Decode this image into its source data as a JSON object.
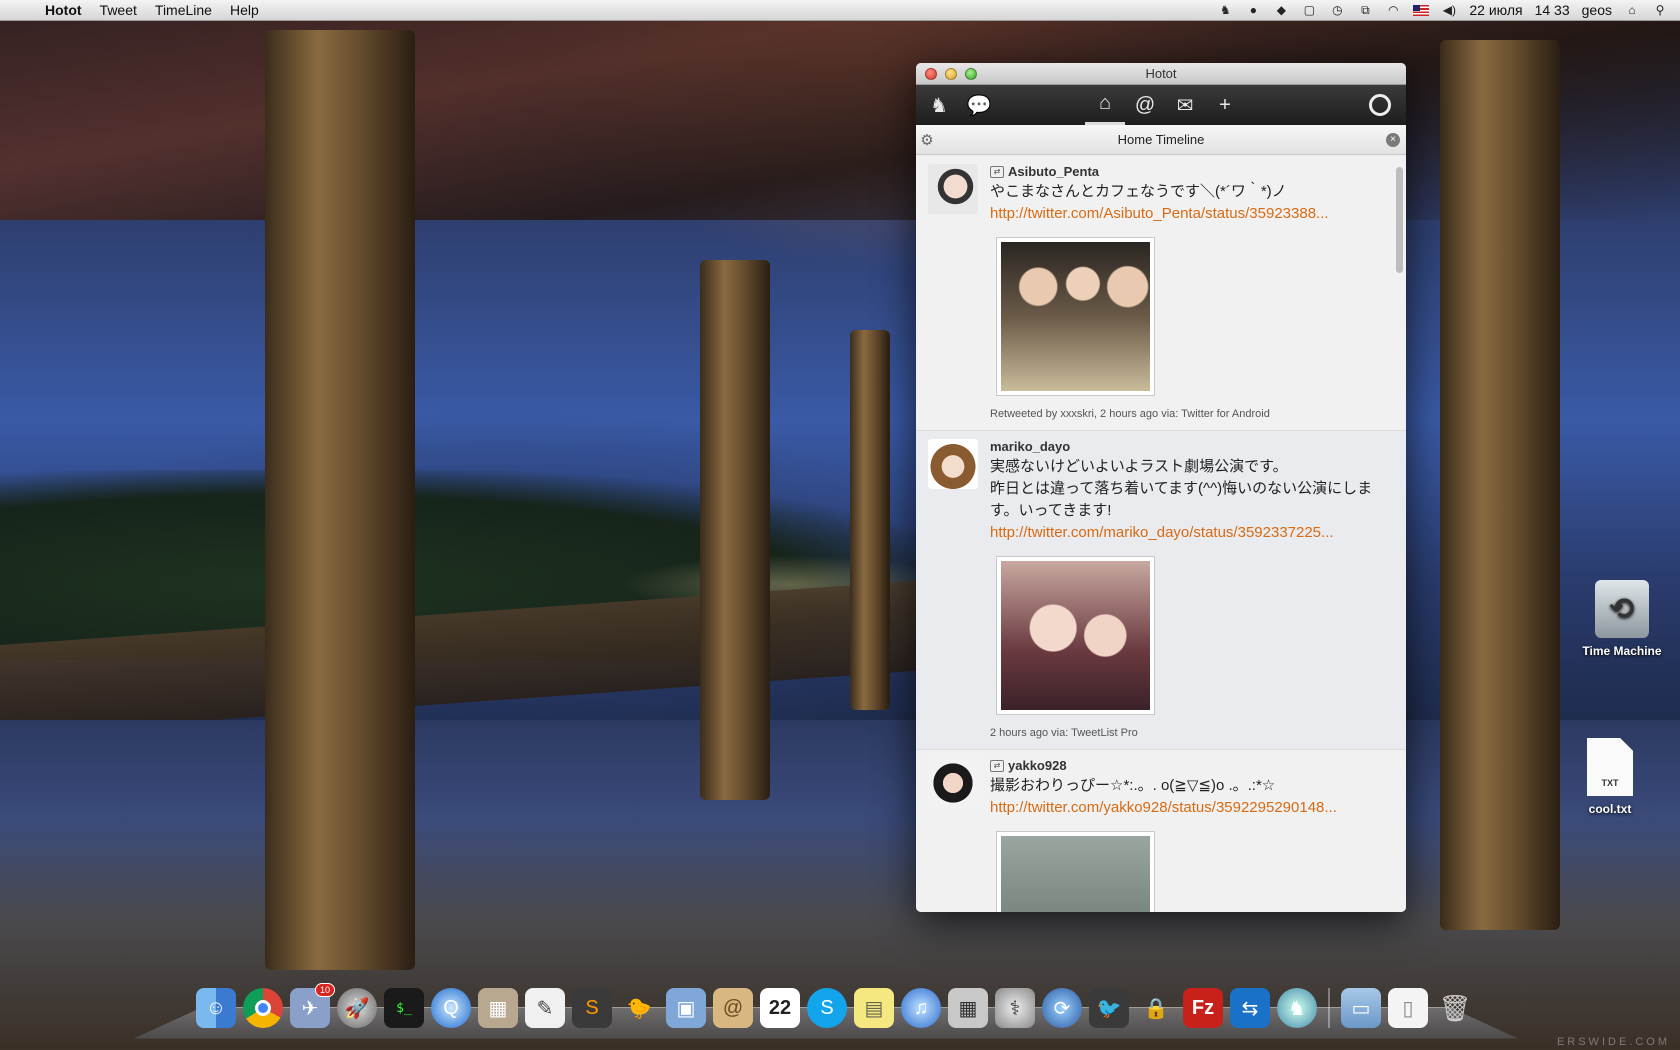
{
  "menubar": {
    "app_name": "Hotot",
    "menus": [
      "Tweet",
      "TimeLine",
      "Help"
    ],
    "date": "22 июля",
    "time": "14 33",
    "user": "geos"
  },
  "window": {
    "title": "Hotot",
    "column_title": "Home Timeline"
  },
  "tweets": [
    {
      "user": "Asibuto_Penta",
      "text": "やこまなさんとカフェなうです＼(*´ワ｀*)ノ",
      "link": "http://twitter.com/Asibuto_Penta/status/35923388...",
      "meta": "Retweeted by xxxskri, 2 hours ago via: Twitter for Android"
    },
    {
      "user": "mariko_dayo",
      "text": "実感ないけどいよいよラスト劇場公演です。\n昨日とは違って落ち着いてます(^^)悔いのない公演にします。いってきます!",
      "link": "http://twitter.com/mariko_dayo/status/3592337225...",
      "meta": "2 hours ago via: TweetList Pro"
    },
    {
      "user": "yakko928",
      "text": "撮影おわりっぴー☆*:.。. o(≧▽≦)o .。.:*☆",
      "link": "http://twitter.com/yakko928/status/3592295290148..."
    }
  ],
  "desktop_icons": [
    {
      "label": "Time Machine"
    },
    {
      "label": "cool.txt",
      "badge": "TXT"
    }
  ],
  "dock": {
    "mail_badge": "10",
    "calendar_day": "22"
  },
  "watermark": "ERSWIDE.COM"
}
